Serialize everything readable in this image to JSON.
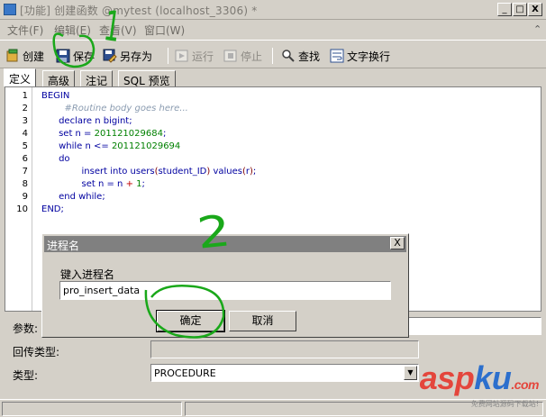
{
  "window": {
    "title": "[功能] 创建函数 @mytest (localhost_3306) *",
    "controls": [
      "_",
      "□",
      "X"
    ]
  },
  "menu": {
    "items": [
      "文件(F)",
      "编辑(E)",
      "查看(V)",
      "窗口(W)"
    ]
  },
  "toolbar": {
    "create": "创建",
    "save": "保存",
    "save_as": "另存为",
    "run": "运行",
    "stop": "停止",
    "find": "查找",
    "word_wrap": "文字换行"
  },
  "tabs": [
    "定义",
    "高级",
    "注记",
    "SQL 预览"
  ],
  "editor": {
    "line_numbers": [
      "1",
      "2",
      "3",
      "4",
      "5",
      "6",
      "7",
      "8",
      "9",
      "10"
    ]
  },
  "props": {
    "params_label": "参数:",
    "return_type_label": "回传类型:",
    "type_label": "类型:",
    "type_value": "PROCEDURE"
  },
  "dialog": {
    "title": "进程名",
    "close": "X",
    "prompt": "键入进程名",
    "input_value": "pro_insert_data",
    "ok": "确定",
    "cancel": "取消"
  },
  "annotations": {
    "mark_1": "1",
    "mark_2": "2"
  },
  "watermark": {
    "subtitle": "免费网站源码下载站!"
  }
}
